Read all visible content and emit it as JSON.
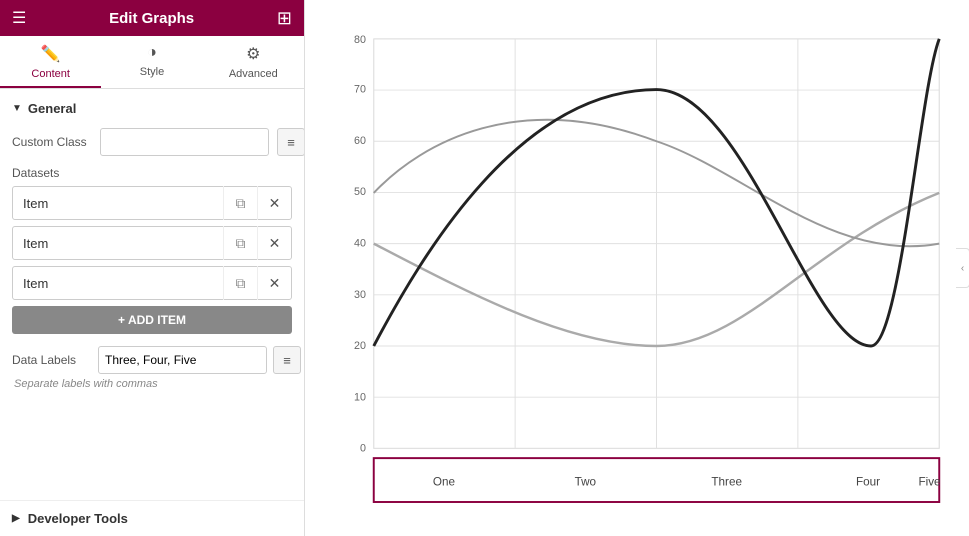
{
  "header": {
    "title": "Edit Graphs",
    "hamburger_icon": "☰",
    "grid_icon": "⊞"
  },
  "tabs": [
    {
      "id": "content",
      "label": "Content",
      "icon": "✏️",
      "active": true
    },
    {
      "id": "style",
      "label": "Style",
      "icon": "◑"
    },
    {
      "id": "advanced",
      "label": "Advanced",
      "icon": "⚙"
    }
  ],
  "general": {
    "section_label": "General",
    "custom_class_label": "Custom Class",
    "custom_class_placeholder": "",
    "datasets_label": "Datasets",
    "items": [
      {
        "label": "Item"
      },
      {
        "label": "Item"
      },
      {
        "label": "Item"
      }
    ],
    "add_item_label": "+ ADD ITEM",
    "data_labels_label": "Data Labels",
    "data_labels_value": "Three, Four, Five",
    "hint_text": "Separate labels with commas"
  },
  "developer_tools": {
    "label": "Developer Tools"
  },
  "chart": {
    "y_labels": [
      "0",
      "10",
      "20",
      "30",
      "40",
      "50",
      "60",
      "70",
      "80"
    ],
    "x_labels": [
      "One",
      "Two",
      "Three",
      "Four",
      "Five"
    ],
    "x_label_highlight": true
  },
  "collapse_handle": {
    "icon": "‹"
  }
}
